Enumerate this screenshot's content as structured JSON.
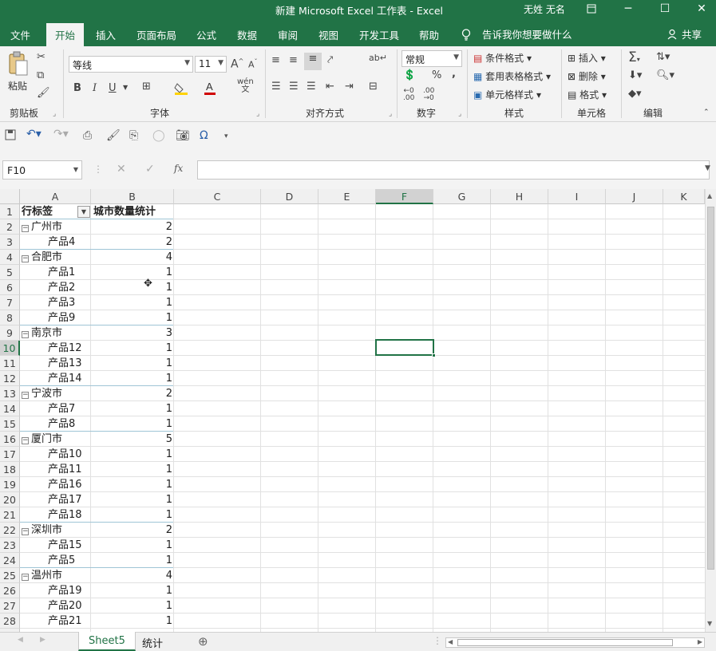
{
  "titlebar": {
    "title": "新建 Microsoft Excel 工作表  -  Excel",
    "user": "无姓 无名",
    "restore_icon": "ribbon-display-icon",
    "minimize": "─",
    "maximize": "☐",
    "close": "✕"
  },
  "menu": {
    "tabs": [
      "文件",
      "开始",
      "插入",
      "页面布局",
      "公式",
      "数据",
      "审阅",
      "视图",
      "开发工具",
      "帮助"
    ],
    "active_tab": "开始",
    "tell_me": "告诉我你想要做什么",
    "share": "共享"
  },
  "ribbon": {
    "clipboard": {
      "label": "剪贴板",
      "paste": "粘贴"
    },
    "font": {
      "label": "字体",
      "font_name": "等线",
      "font_size": "11",
      "bold": "B",
      "italic": "I",
      "underline": "U",
      "grow": "A",
      "shrink": "A",
      "wen": "wén"
    },
    "alignment": {
      "label": "对齐方式"
    },
    "number": {
      "label": "数字",
      "format": "常规",
      "percent": "%",
      "comma": ","
    },
    "styles": {
      "label": "样式",
      "conditional": "条件格式",
      "table": "套用表格格式",
      "cell_styles": "单元格样式"
    },
    "cells": {
      "label": "单元格",
      "insert": "插入",
      "delete": "删除",
      "format": "格式"
    },
    "editing": {
      "label": "编辑",
      "sum": "Σ"
    }
  },
  "formula_bar": {
    "name_box": "F10",
    "fx": "fx",
    "value": ""
  },
  "columns": [
    "A",
    "B",
    "C",
    "D",
    "E",
    "F",
    "G",
    "H",
    "I",
    "J",
    "K"
  ],
  "selected_column": "F",
  "selected_row": "10",
  "pivot": {
    "header_a": "行标签",
    "header_b": "城市数量统计",
    "rows": [
      {
        "row": "1",
        "type": "header"
      },
      {
        "row": "2",
        "type": "group",
        "label": "广州市",
        "value": "2"
      },
      {
        "row": "3",
        "type": "item",
        "label": "产品4",
        "value": "2"
      },
      {
        "row": "4",
        "type": "group",
        "label": "合肥市",
        "value": "4"
      },
      {
        "row": "5",
        "type": "item",
        "label": "产品1",
        "value": "1"
      },
      {
        "row": "6",
        "type": "item",
        "label": "产品2",
        "value": "1"
      },
      {
        "row": "7",
        "type": "item",
        "label": "产品3",
        "value": "1"
      },
      {
        "row": "8",
        "type": "item",
        "label": "产品9",
        "value": "1"
      },
      {
        "row": "9",
        "type": "group",
        "label": "南京市",
        "value": "3"
      },
      {
        "row": "10",
        "type": "item",
        "label": "产品12",
        "value": "1"
      },
      {
        "row": "11",
        "type": "item",
        "label": "产品13",
        "value": "1"
      },
      {
        "row": "12",
        "type": "item",
        "label": "产品14",
        "value": "1"
      },
      {
        "row": "13",
        "type": "group",
        "label": "宁波市",
        "value": "2"
      },
      {
        "row": "14",
        "type": "item",
        "label": "产品7",
        "value": "1"
      },
      {
        "row": "15",
        "type": "item",
        "label": "产品8",
        "value": "1"
      },
      {
        "row": "16",
        "type": "group",
        "label": "厦门市",
        "value": "5"
      },
      {
        "row": "17",
        "type": "item",
        "label": "产品10",
        "value": "1"
      },
      {
        "row": "18",
        "type": "item",
        "label": "产品11",
        "value": "1"
      },
      {
        "row": "19",
        "type": "item",
        "label": "产品16",
        "value": "1"
      },
      {
        "row": "20",
        "type": "item",
        "label": "产品17",
        "value": "1"
      },
      {
        "row": "21",
        "type": "item",
        "label": "产品18",
        "value": "1"
      },
      {
        "row": "22",
        "type": "group",
        "label": "深圳市",
        "value": "2"
      },
      {
        "row": "23",
        "type": "item",
        "label": "产品15",
        "value": "1"
      },
      {
        "row": "24",
        "type": "item",
        "label": "产品5",
        "value": "1"
      },
      {
        "row": "25",
        "type": "group",
        "label": "温州市",
        "value": "4"
      },
      {
        "row": "26",
        "type": "item",
        "label": "产品19",
        "value": "1"
      },
      {
        "row": "27",
        "type": "item",
        "label": "产品20",
        "value": "1"
      },
      {
        "row": "28",
        "type": "item",
        "label": "产品21",
        "value": "1"
      }
    ]
  },
  "sheets": {
    "tabs": [
      "Sheet5",
      "统计"
    ],
    "active": "Sheet5",
    "add": "⊕"
  },
  "colors": {
    "accent": "#217346"
  }
}
